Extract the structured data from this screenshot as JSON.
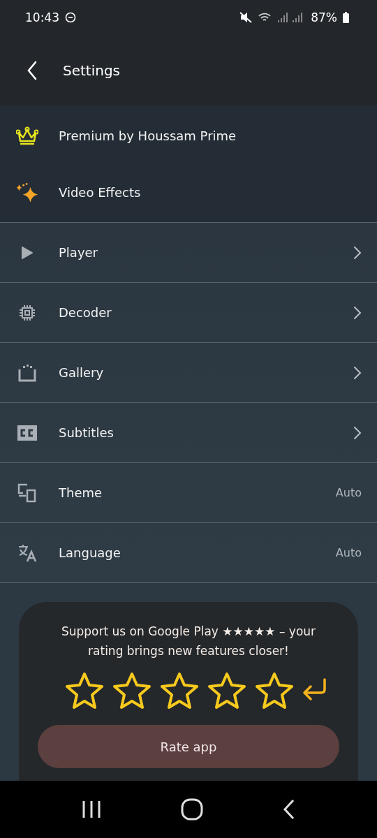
{
  "status_bar": {
    "time": "10:43",
    "battery": "87%"
  },
  "header": {
    "title": "Settings"
  },
  "featured": [
    {
      "label": "Premium by Houssam Prime"
    },
    {
      "label": "Video Effects"
    }
  ],
  "items": [
    {
      "label": "Player",
      "kind": "link"
    },
    {
      "label": "Decoder",
      "kind": "link"
    },
    {
      "label": "Gallery",
      "kind": "link"
    },
    {
      "label": "Subtitles",
      "kind": "link"
    },
    {
      "label": "Theme",
      "kind": "value",
      "value": "Auto"
    },
    {
      "label": "Language",
      "kind": "value",
      "value": "Auto"
    }
  ],
  "rating": {
    "message": "Support us on Google Play ★★★★★ – your rating brings new features closer!",
    "stars": 0,
    "button": "Rate app"
  }
}
